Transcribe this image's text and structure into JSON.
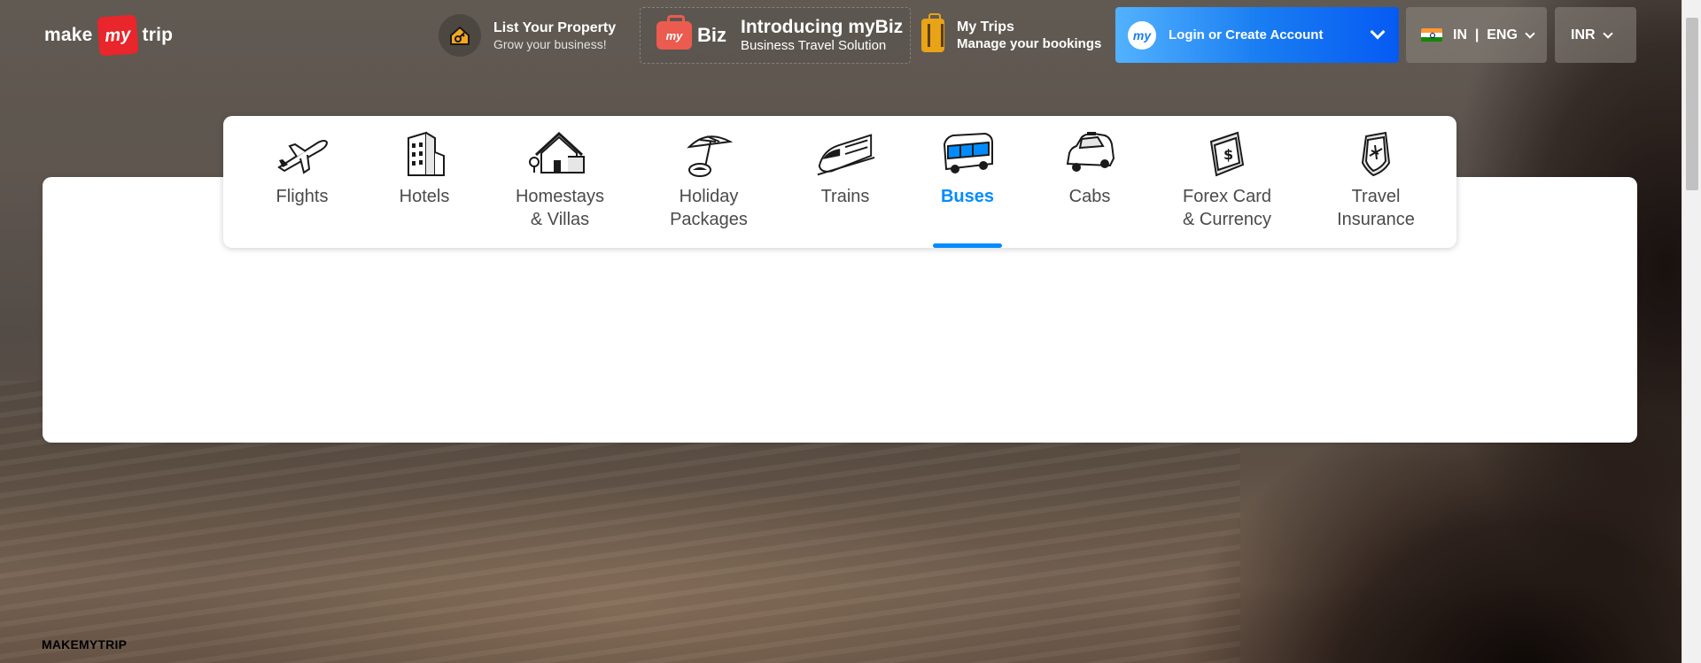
{
  "brand": {
    "logo_left": "make",
    "logo_badge": "my",
    "logo_right": "trip"
  },
  "header": {
    "list_property": {
      "title": "List Your Property",
      "subtitle": "Grow your business!"
    },
    "mybiz": {
      "badge": "my",
      "word": "Biz",
      "title": "Introducing myBiz",
      "subtitle": "Business Travel Solution"
    },
    "my_trips": {
      "title": "My Trips",
      "subtitle": "Manage your bookings"
    },
    "login": {
      "avatar": "my",
      "label": "Login or Create Account"
    },
    "language": {
      "label": "IN  |  ENG"
    },
    "currency": {
      "label": "INR"
    }
  },
  "nav": {
    "active": "Buses",
    "items": [
      {
        "line1": "Flights",
        "line2": "",
        "icon": "airplane-icon"
      },
      {
        "line1": "Hotels",
        "line2": "",
        "icon": "hotel-building-icon"
      },
      {
        "line1": "Homestays",
        "line2": "& Villas",
        "icon": "house-icon"
      },
      {
        "line1": "Holiday",
        "line2": "Packages",
        "icon": "beach-umbrella-icon"
      },
      {
        "line1": "Trains",
        "line2": "",
        "icon": "train-icon"
      },
      {
        "line1": "Buses",
        "line2": "",
        "icon": "bus-icon"
      },
      {
        "line1": "Cabs",
        "line2": "",
        "icon": "car-icon"
      },
      {
        "line1": "Forex Card",
        "line2": "& Currency",
        "icon": "forex-card-icon"
      },
      {
        "line1": "Travel",
        "line2": "Insurance",
        "icon": "insurance-shield-icon"
      }
    ]
  },
  "footer": {
    "label": "MAKEMYTRIP"
  },
  "colors": {
    "accent": "#008cff",
    "login_start": "#53b2fe",
    "login_end": "#065af3",
    "brand_red": "#e8262b"
  }
}
